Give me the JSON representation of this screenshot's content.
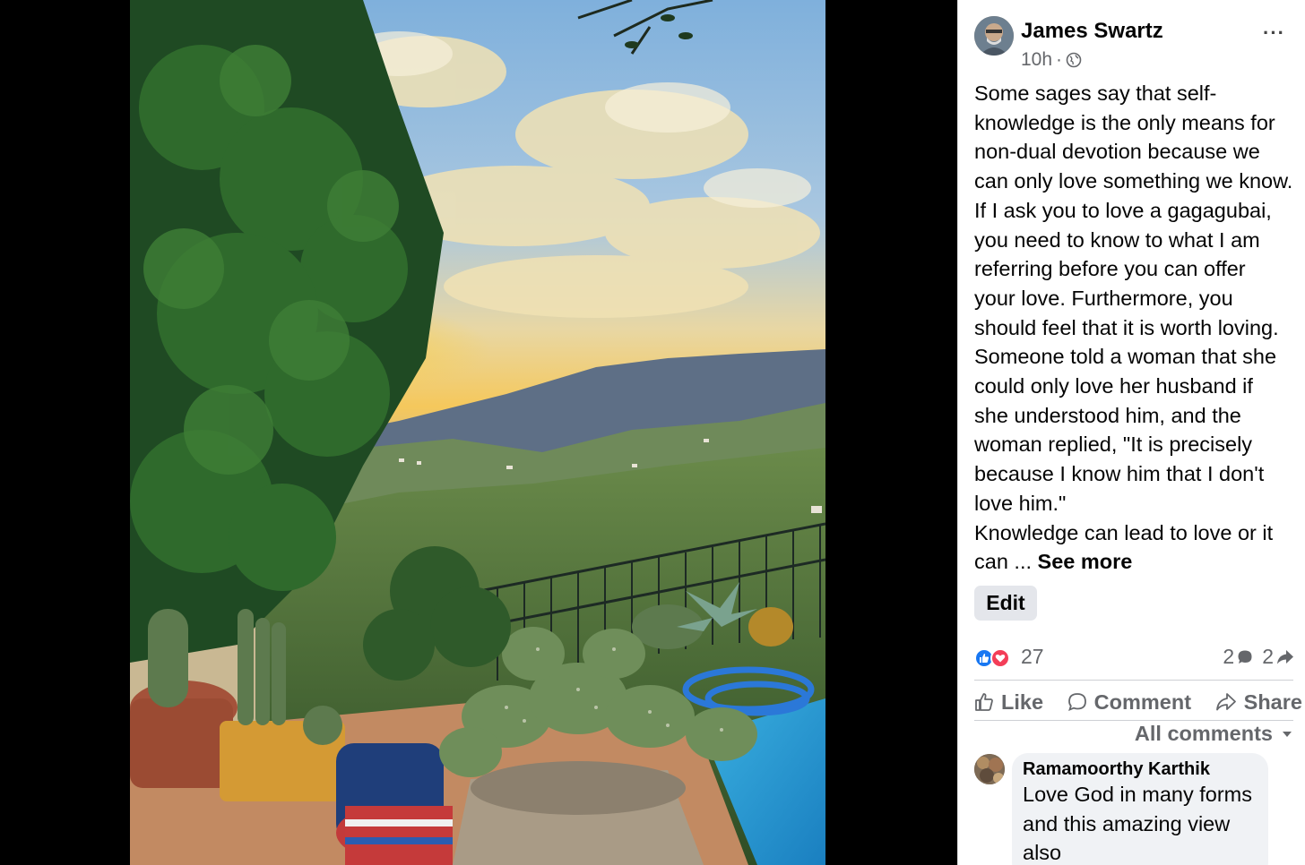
{
  "post": {
    "author": "James Swartz",
    "time": "10h",
    "separator": "·",
    "privacy_icon": "globe-icon",
    "more_label": "···",
    "text_lines": [
      "Some sages say that self-",
      "knowledge is the only means for",
      "non-dual devotion because we",
      "can only love something we know.",
      "If I ask you to love a gagagubai,",
      "you need to know to what I am",
      "referring before you can offer",
      "your love. Furthermore, you",
      "should feel that it is worth loving.",
      "Someone told a woman that she",
      "could only love her husband if",
      "she understood him, and the",
      "woman replied, \"It is precisely",
      "because I know him that I don't",
      "love him.\"",
      "Knowledge can lead to love or it"
    ],
    "last_line_prefix": "can ... ",
    "see_more_label": "See more",
    "edit_label": "Edit",
    "reactions_count": "27",
    "comments_count": "2",
    "shares_count": "2"
  },
  "actions": {
    "like": "Like",
    "comment": "Comment",
    "share": "Share"
  },
  "comments_filter": "All comments",
  "comment": {
    "author": "Ramamoorthy Karthik",
    "lines": [
      "Love God in many forms",
      "and this amazing view",
      "also"
    ]
  },
  "colors": {
    "like_blue": "#1877f2",
    "love_red": "#f33e58",
    "muted_text": "#65676b",
    "bubble_bg": "#f0f2f5"
  }
}
